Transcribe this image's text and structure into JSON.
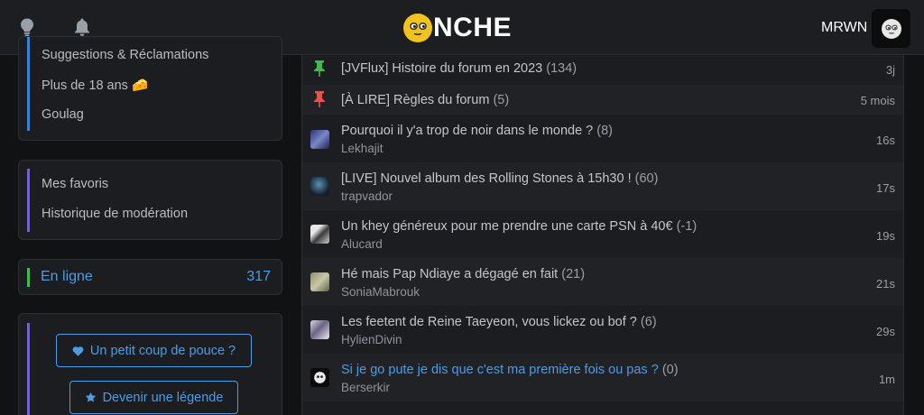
{
  "header": {
    "logo_text": "NCHE",
    "username": "MRWN",
    "icons": [
      "lightbulb-icon",
      "bell-icon"
    ]
  },
  "sidebar": {
    "panel1": {
      "items": [
        "Suggestions & Réclamations",
        "Plus de 18 ans 🧀",
        "Goulag"
      ]
    },
    "panel2": {
      "items": [
        "Mes favoris",
        "Historique de modération"
      ]
    },
    "online": {
      "label": "En ligne",
      "count": "317"
    },
    "support": {
      "coup_de_pouce": "Un petit coup de pouce ?",
      "legende": "Devenir une légende"
    }
  },
  "topics": [
    {
      "title": "[JVFlux] Histoire du forum en 2023",
      "count": "(134)",
      "author": "",
      "time": "3j",
      "pin": "green"
    },
    {
      "title": "[À LIRE] Règles du forum",
      "count": "(5)",
      "author": "",
      "time": "5 mois",
      "pin": "red"
    },
    {
      "title": "Pourquoi il y'a trop de noir dans le monde ?",
      "count": "(8)",
      "author": "Lekhajit",
      "time": "16s"
    },
    {
      "title": "[LIVE] Nouvel album des Rolling Stones à 15h30 !",
      "count": "(60)",
      "author": "trapvador",
      "time": "17s"
    },
    {
      "title": "Un khey généreux pour me prendre une carte PSN à 40€",
      "count": "(-1)",
      "author": "Alucard",
      "time": "19s"
    },
    {
      "title": "Hé mais Pap Ndiaye a dégagé en fait",
      "count": "(21)",
      "author": "SoniaMabrouk",
      "time": "21s"
    },
    {
      "title": "Les feetent de Reine Taeyeon, vous lickez ou bof ?",
      "count": "(6)",
      "author": "HylienDivin",
      "time": "29s"
    },
    {
      "title": "Si je go pute je dis que c'est ma première fois ou pas ?",
      "count": "(0)",
      "author": "Berserkir",
      "time": "1m"
    }
  ],
  "colors": {
    "accent": "#4e9be6",
    "logo_yellow": "#f2c21d",
    "pin_green": "#3fb950",
    "pin_red": "#e5534b"
  }
}
